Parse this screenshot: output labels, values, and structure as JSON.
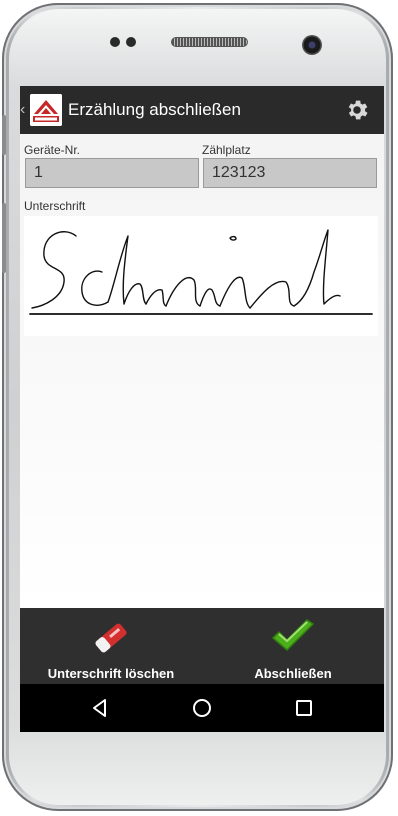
{
  "appbar": {
    "title": "Erzählung abschließen",
    "back_icon": "chevron-left-icon",
    "settings_icon": "gear-icon"
  },
  "form": {
    "device_label": "Geräte-Nr.",
    "device_value": "1",
    "counter_label": "Zählplatz",
    "counter_value": "123123",
    "signature_label": "Unterschrift"
  },
  "actions": {
    "clear_label": "Unterschrift löschen",
    "clear_icon": "eraser-icon",
    "finish_label": "Abschließen",
    "finish_icon": "checkmark-icon"
  },
  "navigation": {
    "back_icon": "nav-back-icon",
    "home_icon": "nav-home-icon",
    "recents_icon": "nav-recents-icon"
  },
  "colors": {
    "appbar": "#2a2a2a",
    "actionbar": "#2f2f2f",
    "accent_green": "#4caf1a",
    "eraser_red": "#d32f2f"
  }
}
